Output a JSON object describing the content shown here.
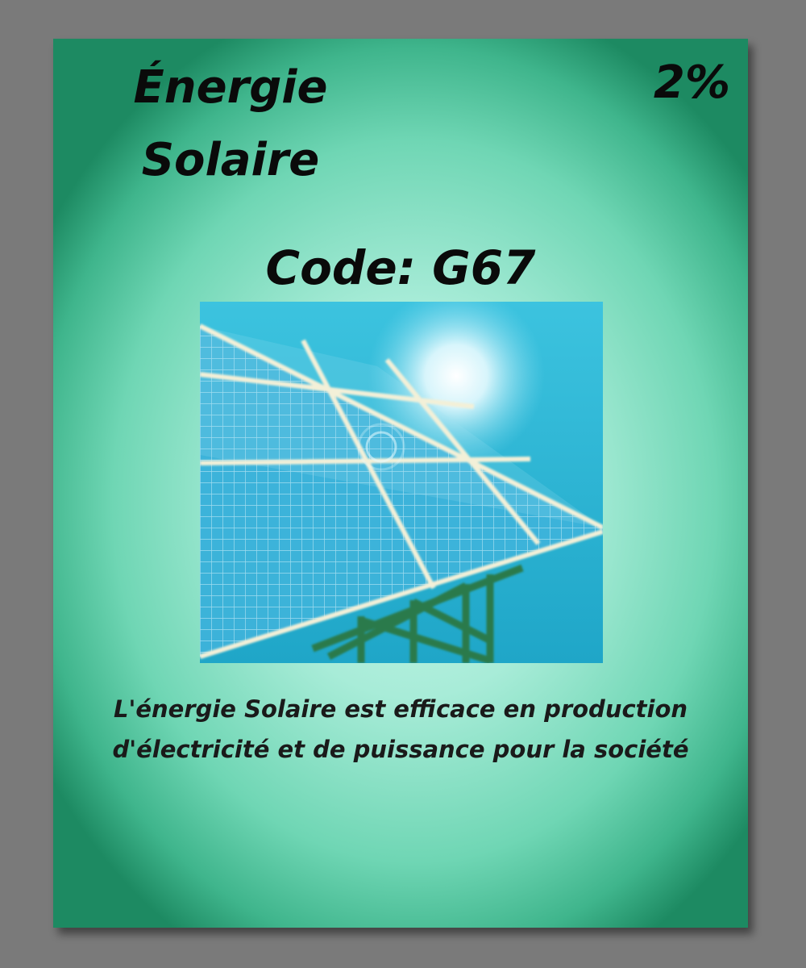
{
  "card": {
    "title_line1": "Énergie",
    "title_line2": "Solaire",
    "percent": "2%",
    "code": "Code: G67",
    "description": "L'énergie Solaire est efficace en production d'électricité et de puissance pour la société",
    "image_icon": "solar-panel-icon",
    "colors": {
      "card_center": "#c9f7ea",
      "card_edge": "#1d8a62",
      "sky": "#2fb6d6",
      "panel_cell": "#3fb4d8",
      "panel_frame": "#f3f0d8",
      "support": "#2b7a4b"
    }
  }
}
